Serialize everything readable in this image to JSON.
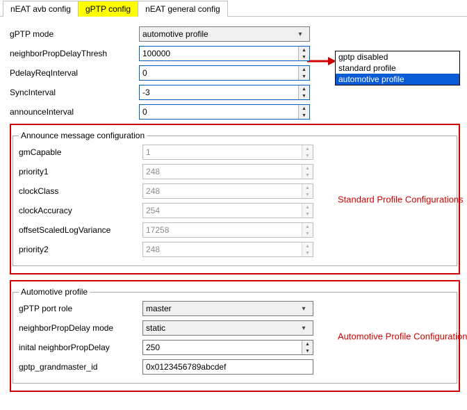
{
  "tabs": [
    {
      "label": "nEAT avb config"
    },
    {
      "label": "gPTP config"
    },
    {
      "label": "nEAT general config"
    }
  ],
  "activeTab": 1,
  "gptpMode": {
    "label": "gPTP mode",
    "value": "automotive profile"
  },
  "dropdown": {
    "opt0": "gptp disabled",
    "opt1": "standard profile",
    "opt2": "automotive profile"
  },
  "neighborPropDelayThresh": {
    "label": "neighborPropDelayThresh",
    "value": "100000"
  },
  "pdelayReqInterval": {
    "label": "PdelayReqInterval",
    "value": "0"
  },
  "syncInterval": {
    "label": "SyncInterval",
    "value": "-3"
  },
  "announceInterval": {
    "label": "announceInterval",
    "value": "0"
  },
  "announceGroup": {
    "legend": "Announce message configuration",
    "gmCapable": {
      "label": "gmCapable",
      "value": "1"
    },
    "priority1": {
      "label": "priority1",
      "value": "248"
    },
    "clockClass": {
      "label": "clockClass",
      "value": "248"
    },
    "clockAccuracy": {
      "label": "clockAccuracy",
      "value": "254"
    },
    "offsetScaledLogVariance": {
      "label": "offsetScaledLogVariance",
      "value": "17258"
    },
    "priority2": {
      "label": "priority2",
      "value": "248"
    }
  },
  "autoGroup": {
    "legend": "Automotive profile",
    "gptpPortRole": {
      "label": "gPTP port role",
      "value": "master"
    },
    "neighborPropDelayMode": {
      "label": "neighborPropDelay mode",
      "value": "static"
    },
    "initialNeighborPropDelay": {
      "label": "inital neighborPropDelay",
      "value": "250"
    },
    "gptpGrandmasterId": {
      "label": "gptp_grandmaster_id",
      "value": "0x0123456789abcdef"
    }
  },
  "annotations": {
    "standard": "Standard Profile Configurations",
    "automotive": "Automotive Profile Configurations"
  }
}
